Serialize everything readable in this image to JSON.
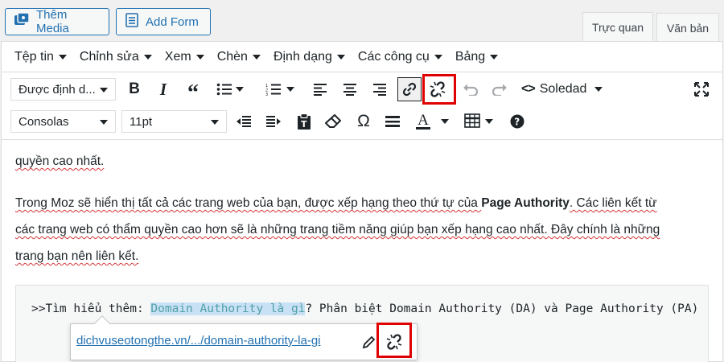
{
  "media_buttons": {
    "add_media_label": "Thêm Media",
    "add_form_label": "Add Form"
  },
  "editor_tabs": {
    "visual_label": "Trực quan",
    "text_label": "Văn bản",
    "active": "visual"
  },
  "menubar": {
    "items": [
      "Tệp tin",
      "Chỉnh sửa",
      "Xem",
      "Chèn",
      "Định dạng",
      "Các công cụ",
      "Bảng"
    ]
  },
  "toolbar1": {
    "format_select": "Được định d...",
    "theme_label": "Soledad",
    "icons": [
      "bold-icon",
      "italic-icon",
      "blockquote-icon",
      "bullet-list-icon",
      "numbered-list-icon",
      "align-left-icon",
      "align-center-icon",
      "align-right-icon",
      "link-icon",
      "unlink-icon",
      "undo-icon",
      "redo-icon",
      "code-icon",
      "fullscreen-icon"
    ]
  },
  "toolbar2": {
    "font_family": "Consolas",
    "font_size": "11pt",
    "icons": [
      "outdent-icon",
      "indent-icon",
      "paste-text-icon",
      "eraser-icon",
      "omega-icon",
      "hr-icon",
      "text-color-icon",
      "table-icon",
      "help-icon"
    ]
  },
  "content": {
    "line1": "quyền cao nhất.",
    "para_a": "Trong Moz sẽ hiển thị tất cả các trang web của bạn, được xếp hạng theo thứ tự của ",
    "para_bold": "Page Authority",
    "para_b": ". Các liên kết từ",
    "para_c": "các trang web có thẩm quyền cao hơn sẽ là những trang tiềm năng giúp bạn xếp hạng cao nhất. Đây chính là những",
    "para_d": "trang bạn nên liên kết."
  },
  "code_block": {
    "prefix": ">>Tìm hiểu thêm: ",
    "link_text": "Domain Authority là gì",
    "suffix": "? Phân biệt Domain Authority (DA) và Page Authority (PA)"
  },
  "link_popup": {
    "url": "dichvuseotongthe.vn/.../domain-authority-la-gi"
  },
  "colors": {
    "accent": "#2271b1",
    "highlight_box": "#e00000",
    "spellcheck": "#d63638"
  }
}
